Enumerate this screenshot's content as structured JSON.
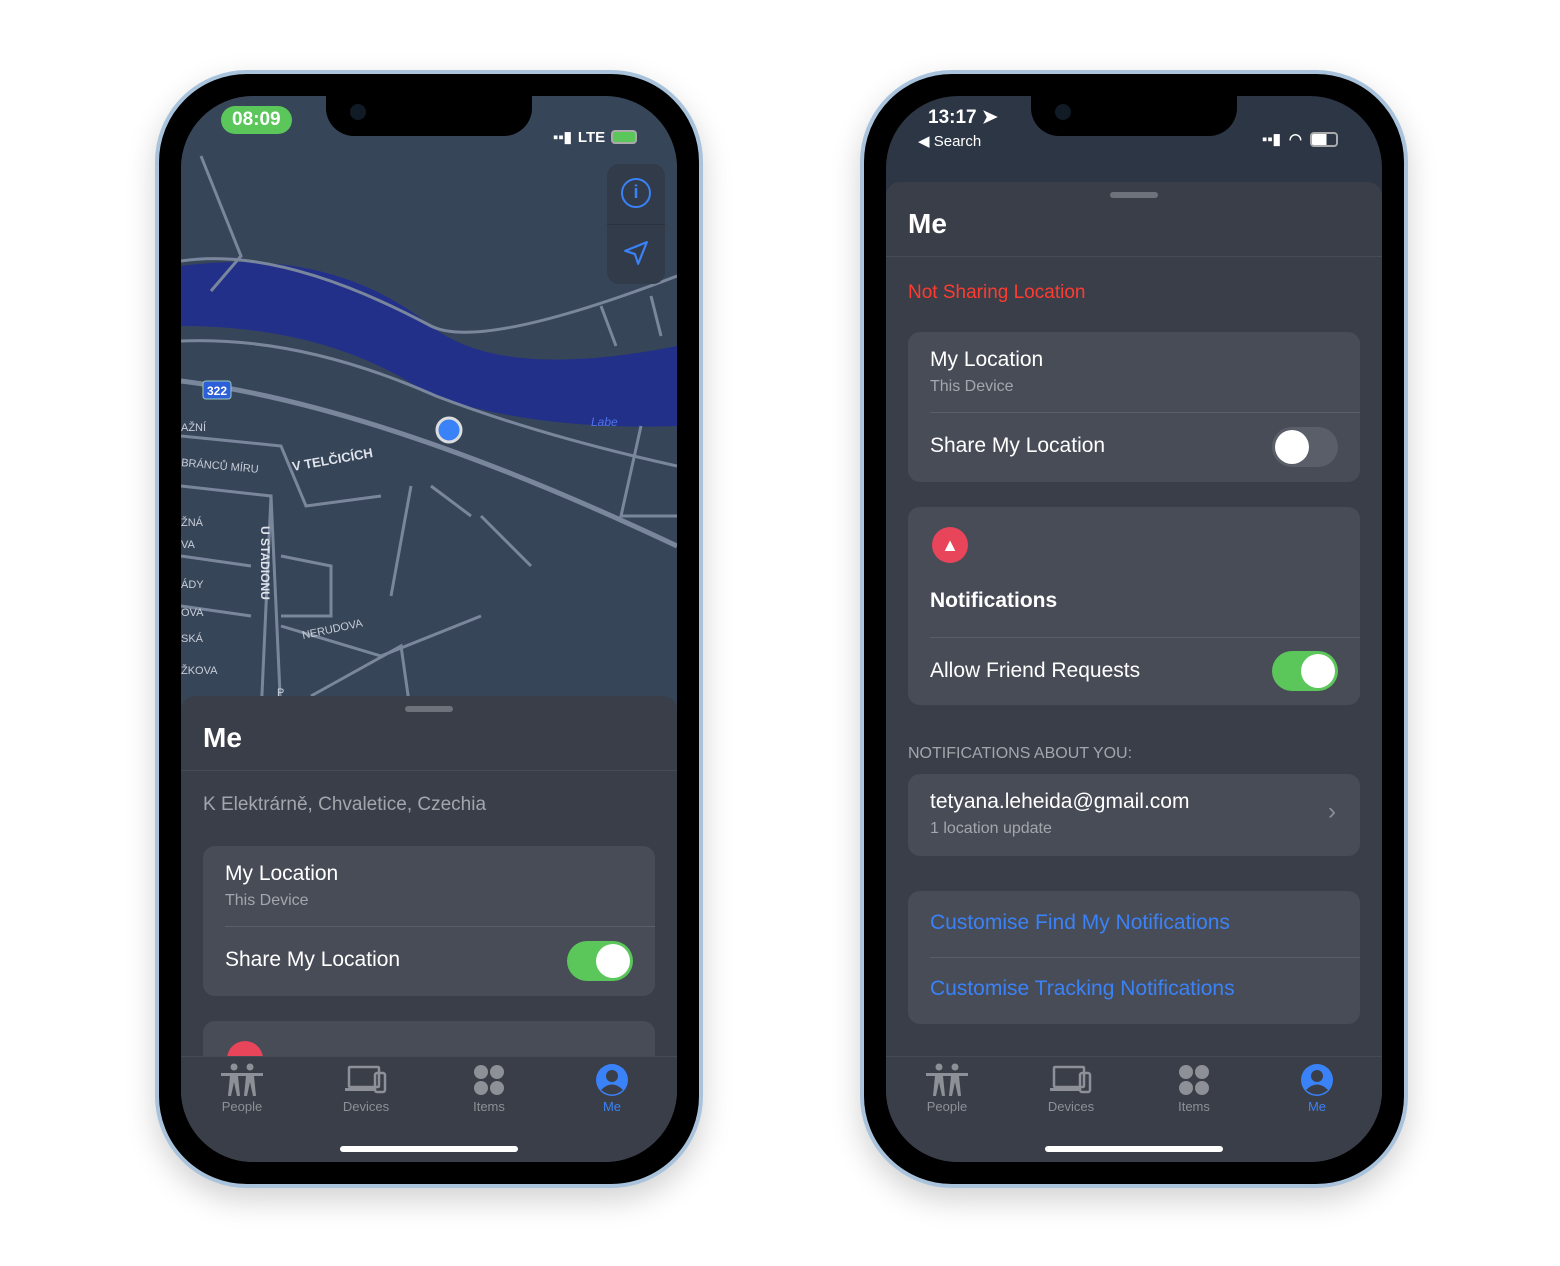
{
  "colors": {
    "accent": "#3a82f7",
    "toggle_on": "#5bc65a",
    "warning": "#ff3b30",
    "notification_badge": "#e8445a"
  },
  "left_phone": {
    "status": {
      "time": "08:09",
      "network": "LTE"
    },
    "map": {
      "route_badge": "322",
      "river_label": "Labe",
      "streets": [
        "V TELČICÍCH",
        "U STADIONU",
        "NERUDOVA",
        "BRÁNCŮ MÍRU",
        "AŽNÍ",
        "ŽNÁ",
        "VA",
        "ÁDY",
        "OVA",
        "SKÁ",
        "ŽKOVA",
        "P"
      ],
      "buttons": [
        "info-icon",
        "location-arrow-icon"
      ]
    },
    "sheet": {
      "title": "Me",
      "address": "K Elektrárně, Chvaletice, Czechia",
      "my_location": {
        "label": "My Location",
        "sub": "This Device"
      },
      "share": {
        "label": "Share My Location",
        "on": true
      }
    }
  },
  "right_phone": {
    "status": {
      "time": "13:17",
      "back": "Search"
    },
    "sheet": {
      "title": "Me",
      "warning": "Not Sharing Location",
      "my_location": {
        "label": "My Location",
        "sub": "This Device"
      },
      "share": {
        "label": "Share My Location",
        "on": false
      },
      "notifications": {
        "title": "Notifications",
        "allow": "Allow Friend Requests",
        "allow_on": true
      },
      "about_header": "NOTIFICATIONS ABOUT YOU:",
      "about_item": {
        "email": "tetyana.leheida@gmail.com",
        "sub": "1 location update"
      },
      "links": [
        "Customise Find My Notifications",
        "Customise Tracking Notifications"
      ]
    }
  },
  "tabs": [
    {
      "label": "People",
      "icon": "people-icon"
    },
    {
      "label": "Devices",
      "icon": "devices-icon"
    },
    {
      "label": "Items",
      "icon": "items-icon"
    },
    {
      "label": "Me",
      "icon": "me-icon",
      "active": true
    }
  ]
}
